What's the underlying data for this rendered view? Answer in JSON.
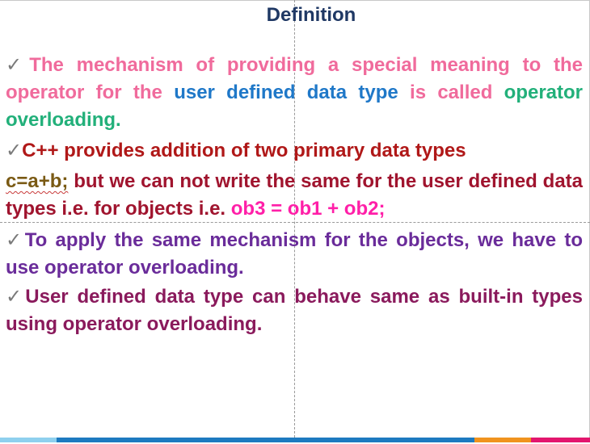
{
  "slide": {
    "title": "Definition",
    "check_glyph": "✓",
    "p1": {
      "a": "The mechanism of providing a special meaning to the operator for the ",
      "b": "user defined data type",
      "c": " is called ",
      "d": "operator overloading."
    },
    "p2": "C++ provides addition of two primary data types",
    "p3": {
      "a": "c=a+b;",
      "b": "  but we can not write the same for the user defined data types i.e.  for objects   i.e. ",
      "c": "ob3 = ob1 + ob2;"
    },
    "p4": "To apply the same mechanism for the objects, we have to use operator overloading.",
    "p5": "User defined data type can behave same as built-in types using operator overloading."
  },
  "colors": {
    "title": "#1f3864",
    "pink": "#f06b9c",
    "blue": "#1f78c8",
    "green": "#22b07a",
    "dark_red": "#b01818",
    "maroon": "#a0142e",
    "magenta": "#ff1fa8",
    "purple": "#6a2c9a",
    "plum": "#8a1a5c",
    "bar": [
      "#8fd0ee",
      "#1d7ac0",
      "#f0931e",
      "#e3166e"
    ]
  },
  "icons": {
    "bullet": "check-mark-icon"
  }
}
